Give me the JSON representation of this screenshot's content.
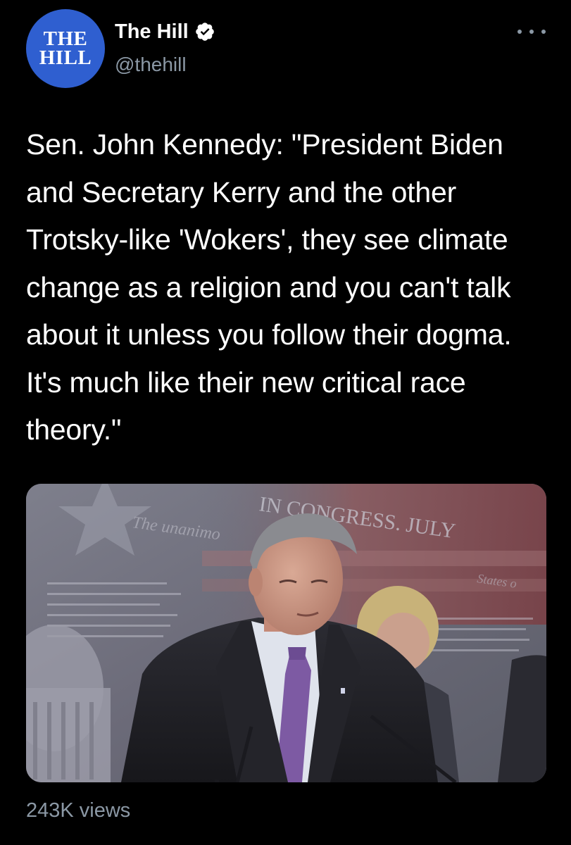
{
  "account": {
    "avatar_line1": "THE",
    "avatar_line2": "HILL",
    "display_name": "The Hill",
    "handle": "@thehill",
    "verified": true,
    "brand_color": "#2f5fd0"
  },
  "tweet": {
    "text": "Sen. John Kennedy: \"President Biden and Secretary Kerry and the other Trotsky-like 'Wokers', they see climate change as a religion and you can't talk about it unless you follow their dogma. It's much like their new critical race theory.\""
  },
  "media": {
    "type": "video",
    "backdrop_text1": "IN CONGRESS. JULY",
    "backdrop_text2": "The unanimo",
    "backdrop_text3": "States o"
  },
  "footer": {
    "views": "243K views"
  },
  "icons": {
    "more": "more-horizontal-icon",
    "verified": "verified-badge-icon"
  }
}
